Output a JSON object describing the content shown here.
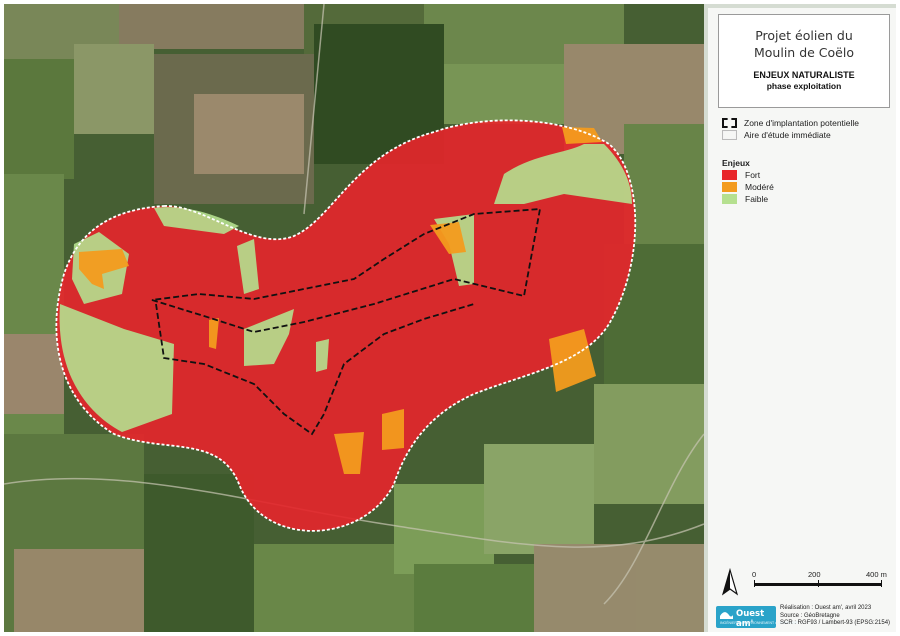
{
  "title": {
    "line1": "Projet éolien du",
    "line2": "Moulin de Coëlo",
    "subtitle": "ENJEUX NATURALISTE",
    "subtitle2": "phase exploitation"
  },
  "boundaries": {
    "zip_label": "Zone d'implantation potentielle",
    "aei_label": "Aire d'étude immédiate"
  },
  "legend": {
    "heading": "Enjeux",
    "items": [
      {
        "label": "Fort",
        "color": "#e8262a"
      },
      {
        "label": "Modéré",
        "color": "#f39b1e"
      },
      {
        "label": "Faible",
        "color": "#b5e08f"
      }
    ]
  },
  "scale": {
    "labels": [
      "0",
      "200",
      "400 m"
    ]
  },
  "logo": {
    "name": "Ouest am'",
    "tagline": "INGÉNIERIE • ENVIRONNEMENT • URBANISME"
  },
  "credits": {
    "line1": "Réalisation : Ouest am', avril 2023",
    "line2": "Source : GéoBretagne",
    "line3": "SCR : RGF93 / Lambert-93 (EPSG:2154)"
  },
  "colors": {
    "map_background": "#3f5a2c",
    "panel_background": "#ffffff"
  },
  "icons": [
    "north-arrow-icon",
    "wave-logo-icon"
  ]
}
